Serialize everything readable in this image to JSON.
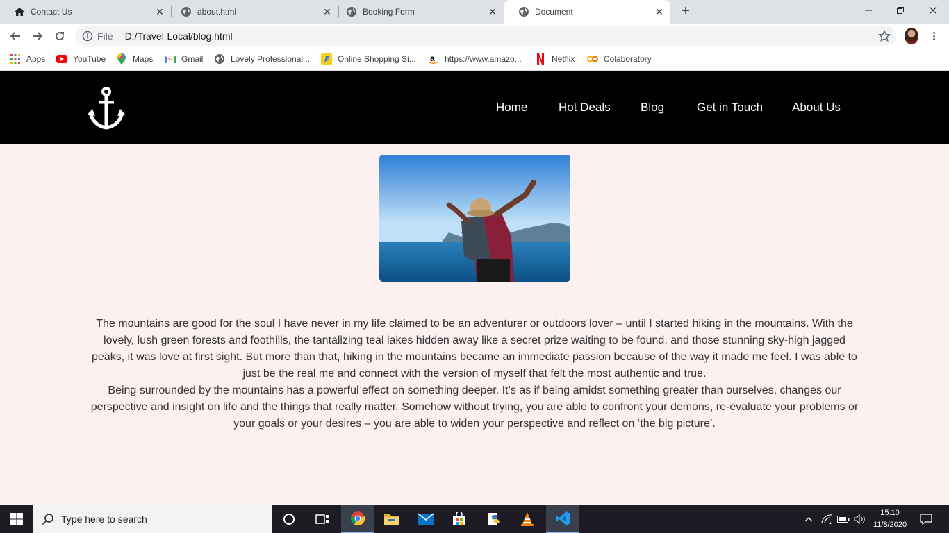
{
  "browser": {
    "tabs": [
      {
        "title": "Contact Us",
        "icon": "home-icon"
      },
      {
        "title": "about.html",
        "icon": "globe-icon"
      },
      {
        "title": "Booking Form",
        "icon": "globe-icon"
      },
      {
        "title": "Document",
        "icon": "globe-icon",
        "active": true
      }
    ],
    "new_tab_label": "+",
    "address": {
      "scheme_label": "File",
      "url": "D:/Travel-Local/blog.html"
    },
    "bookmarks": [
      {
        "label": "Apps",
        "icon": "apps-grid-icon"
      },
      {
        "label": "YouTube",
        "icon": "youtube-icon"
      },
      {
        "label": "Maps",
        "icon": "maps-pin-icon"
      },
      {
        "label": "Gmail",
        "icon": "gmail-icon"
      },
      {
        "label": "Lovely Professional...",
        "icon": "globe-icon"
      },
      {
        "label": "Online Shopping Si...",
        "icon": "flipkart-icon"
      },
      {
        "label": "https://www.amazo...",
        "icon": "amazon-icon"
      },
      {
        "label": "Netflix",
        "icon": "netflix-icon"
      },
      {
        "label": "Colaboratory",
        "icon": "colab-icon"
      }
    ]
  },
  "site": {
    "logo": "anchor-icon",
    "nav": [
      "Home",
      "Hot Deals",
      "Blog",
      "Get in Touch",
      "About Us"
    ],
    "article": {
      "paragraph1": "The mountains are good for the soul I have never in my life claimed to be an adventurer or outdoors lover – until I started hiking in the mountains. With the lovely, lush green forests and foothills, the tantalizing teal lakes hidden away like a secret prize waiting to be found, and those stunning sky-high jagged peaks, it was love at first sight. But more than that, hiking in the mountains became an immediate passion because of the way it made me feel. I was able to just be the real me and connect with the version of myself that felt the most authentic and true.",
      "paragraph2": "Being surrounded by the mountains has a powerful effect on something deeper. It’s as if being amidst something greater than ourselves, changes our perspective and insight on life and the things that really matter. Somehow without trying, you are able to confront your demons, re-evaluate your problems or your goals or your desires – you are able to widen your perspective and reflect on ‘the big picture’."
    },
    "colors": {
      "navbar": "#000000",
      "page_bg": "#fdf0f0",
      "text": "#333333"
    }
  },
  "taskbar": {
    "search_placeholder": "Type here to search",
    "clock_time": "15:10",
    "clock_date": "11/8/2020"
  }
}
